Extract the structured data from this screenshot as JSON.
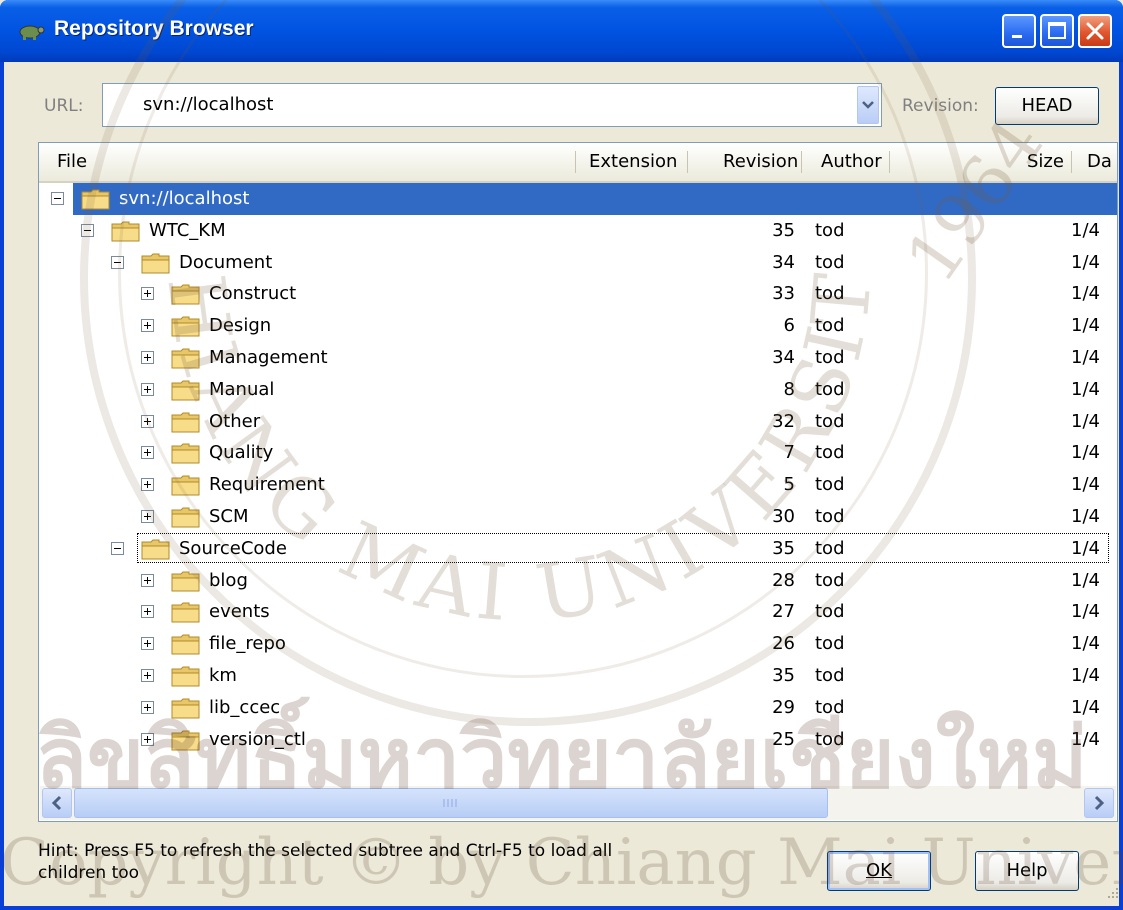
{
  "window": {
    "title": "Repository Browser"
  },
  "toolbar": {
    "url_label": "URL:",
    "url_value": "svn://localhost",
    "revision_label": "Revision:",
    "revision_button": "HEAD"
  },
  "columns": [
    "File",
    "Extension",
    "Revision",
    "Author",
    "Size",
    "Da"
  ],
  "tree": [
    {
      "name": "svn://localhost",
      "level": 0,
      "expander": "minus",
      "revision": "",
      "author": "",
      "date": "",
      "selected": true
    },
    {
      "name": "WTC_KM",
      "level": 1,
      "expander": "minus",
      "revision": "35",
      "author": "tod",
      "date": "1/4"
    },
    {
      "name": "Document",
      "level": 2,
      "expander": "minus",
      "revision": "34",
      "author": "tod",
      "date": "1/4"
    },
    {
      "name": "Construct",
      "level": 3,
      "expander": "plus",
      "revision": "33",
      "author": "tod",
      "date": "1/4"
    },
    {
      "name": "Design",
      "level": 3,
      "expander": "plus",
      "revision": "6",
      "author": "tod",
      "date": "1/4"
    },
    {
      "name": "Management",
      "level": 3,
      "expander": "plus",
      "revision": "34",
      "author": "tod",
      "date": "1/4"
    },
    {
      "name": "Manual",
      "level": 3,
      "expander": "plus",
      "revision": "8",
      "author": "tod",
      "date": "1/4"
    },
    {
      "name": "Other",
      "level": 3,
      "expander": "plus",
      "revision": "32",
      "author": "tod",
      "date": "1/4"
    },
    {
      "name": "Quality",
      "level": 3,
      "expander": "plus",
      "revision": "7",
      "author": "tod",
      "date": "1/4"
    },
    {
      "name": "Requirement",
      "level": 3,
      "expander": "plus",
      "revision": "5",
      "author": "tod",
      "date": "1/4"
    },
    {
      "name": "SCM",
      "level": 3,
      "expander": "plus",
      "revision": "30",
      "author": "tod",
      "date": "1/4"
    },
    {
      "name": "SourceCode",
      "level": 2,
      "expander": "minus",
      "revision": "35",
      "author": "tod",
      "date": "1/4",
      "focused": true
    },
    {
      "name": "blog",
      "level": 3,
      "expander": "plus",
      "revision": "28",
      "author": "tod",
      "date": "1/4"
    },
    {
      "name": "events",
      "level": 3,
      "expander": "plus",
      "revision": "27",
      "author": "tod",
      "date": "1/4"
    },
    {
      "name": "file_repo",
      "level": 3,
      "expander": "plus",
      "revision": "26",
      "author": "tod",
      "date": "1/4"
    },
    {
      "name": "km",
      "level": 3,
      "expander": "plus",
      "revision": "35",
      "author": "tod",
      "date": "1/4"
    },
    {
      "name": "lib_ccec",
      "level": 3,
      "expander": "plus",
      "revision": "29",
      "author": "tod",
      "date": "1/4"
    },
    {
      "name": "version_ctl",
      "level": 3,
      "expander": "plus",
      "revision": "25",
      "author": "tod",
      "date": "1/4"
    }
  ],
  "footer": {
    "hint": "Hint: Press F5 to refresh the selected subtree and Ctrl-F5 to load all children too",
    "ok_button": "OK",
    "help_button": "Help"
  },
  "watermark": {
    "line1": "ลิขสิทธิ์มหาวิทยาลัยเชียงใหม่",
    "line2": "Copyright © by Chiang Mai University",
    "year": "1964",
    "arc_text": "CHIANG MAI UNIVERSITY"
  },
  "colors": {
    "title_bar": "#0053e1",
    "selection": "#316ac5",
    "dialog_bg": "#ece9d8",
    "watermark": "#785a3c"
  },
  "icons": [
    "tortoise-app-icon",
    "minimize-icon",
    "maximize-icon",
    "close-icon",
    "dropdown-arrow-icon",
    "folder-icon",
    "expand-icon",
    "collapse-icon",
    "scroll-left-icon",
    "scroll-right-icon",
    "resize-grip-icon"
  ]
}
